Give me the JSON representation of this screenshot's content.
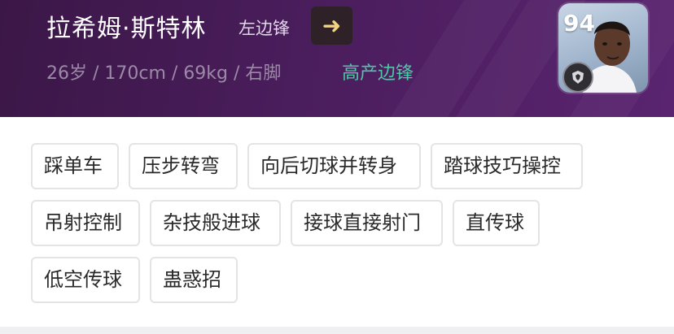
{
  "player": {
    "name": "拉希姆·斯特林",
    "position": "左边锋",
    "bio": "26岁 / 170cm / 69kg / 右脚",
    "playstyle": "高产边锋",
    "rating": "94",
    "compare_icon": "arrow-right-icon"
  },
  "skills": [
    "踩单车",
    "压步转弯",
    "向后切球并转身",
    "踏球技巧操控",
    "吊射控制",
    "杂技般进球",
    "接球直接射门",
    "直传球",
    "低空传球",
    "蛊惑招"
  ],
  "colors": {
    "header_bg": "#4a1d5c",
    "playstyle": "#4fc8a5",
    "arrow": "#f3d37c"
  }
}
